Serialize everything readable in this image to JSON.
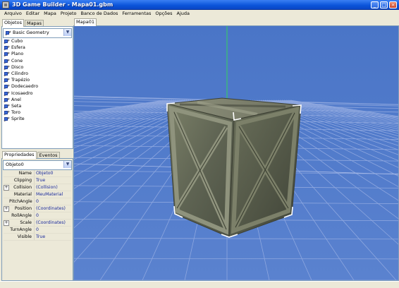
{
  "window": {
    "title": "3D Game Builder - Mapa01.gbm",
    "controls": {
      "minimize": "_",
      "maximize": "□",
      "close": "×"
    }
  },
  "menu": [
    "Arquivo",
    "Editar",
    "Mapa",
    "Projeto",
    "Banco de Dados",
    "Ferramentas",
    "Opções",
    "Ajuda"
  ],
  "left_top": {
    "tabs": [
      {
        "label": "Objetos",
        "active": true
      },
      {
        "label": "Mapas",
        "active": false
      }
    ],
    "category": "Basic Geometry",
    "objects": [
      "Cubo",
      "Esfera",
      "Plano",
      "Cone",
      "Disco",
      "Cilindro",
      "Trapézio",
      "Dodecaedro",
      "Icosaedro",
      "Anel",
      "Seta",
      "Toro",
      "Sprite"
    ]
  },
  "left_bottom": {
    "tabs": [
      {
        "label": "Propriedades",
        "active": true
      },
      {
        "label": "Eventos",
        "active": false
      }
    ],
    "selected_object": "Objeto0",
    "properties": [
      {
        "name": "Name",
        "value": "Objeto0",
        "expandable": false
      },
      {
        "name": "Clipping",
        "value": "True",
        "expandable": false
      },
      {
        "name": "Collision",
        "value": "(Collision)",
        "expandable": true
      },
      {
        "name": "Material",
        "value": "MeuMaterial",
        "expandable": false
      },
      {
        "name": "PitchAngle",
        "value": "0",
        "expandable": false
      },
      {
        "name": "Position",
        "value": "(Coordinates)",
        "expandable": true
      },
      {
        "name": "RollAngle",
        "value": "0",
        "expandable": false
      },
      {
        "name": "Scale",
        "value": "(Coordinates)",
        "expandable": true
      },
      {
        "name": "TurnAngle",
        "value": "0",
        "expandable": false
      },
      {
        "name": "Visible",
        "value": "True",
        "expandable": false
      }
    ]
  },
  "viewport": {
    "tab": "Mapa01",
    "colors": {
      "sky": "#4f79c9",
      "grid": "#8fa8df",
      "axis_y": "#32d05a",
      "crate": "#6e735f"
    }
  }
}
